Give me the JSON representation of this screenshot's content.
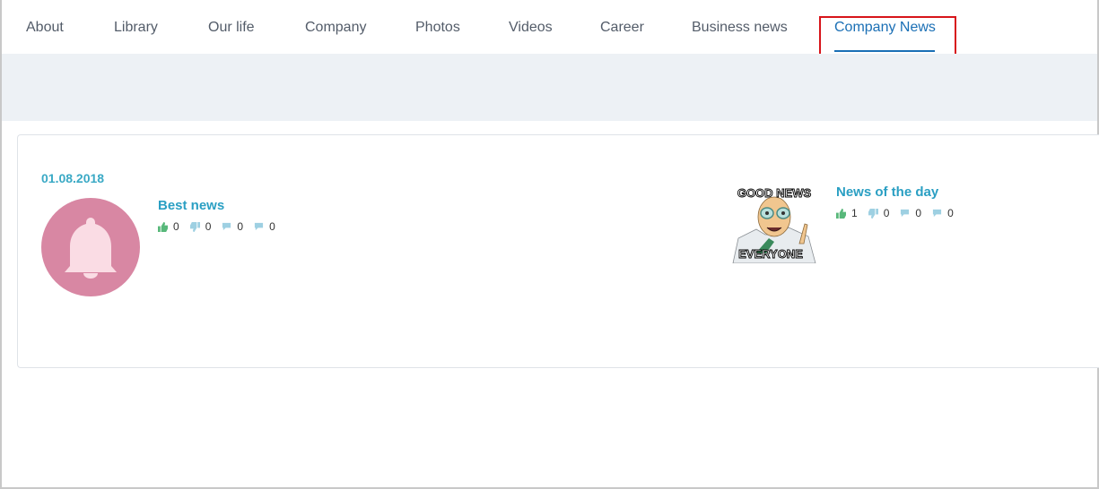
{
  "nav": {
    "tabs": [
      {
        "label": "About"
      },
      {
        "label": "Library"
      },
      {
        "label": "Our life"
      },
      {
        "label": "Company"
      },
      {
        "label": "Photos"
      },
      {
        "label": "Videos"
      },
      {
        "label": "Career"
      },
      {
        "label": "Business news"
      },
      {
        "label": "Company News"
      }
    ],
    "active_tab": "Company News"
  },
  "news": {
    "date": "01.08.2018",
    "items": [
      {
        "title": "Best news",
        "likes": "0",
        "dislikes": "0",
        "reposts": "0",
        "comments": "0",
        "image_icon": "bell-icon"
      },
      {
        "title": "News of the day",
        "likes": "1",
        "dislikes": "0",
        "reposts": "0",
        "comments": "0",
        "image_icon": "meme-image",
        "image_text_top": "GOOD NEWS",
        "image_text_bottom": "EVERYONE"
      }
    ]
  },
  "colors": {
    "accent": "#1a6fb5",
    "title": "#2a9fc3",
    "date": "#3aa9c5",
    "avatar": "#d887a3",
    "highlight": "#d7141a",
    "band": "#edf1f5",
    "like": "#58b87a",
    "muted_icon": "#9ed0e2"
  }
}
